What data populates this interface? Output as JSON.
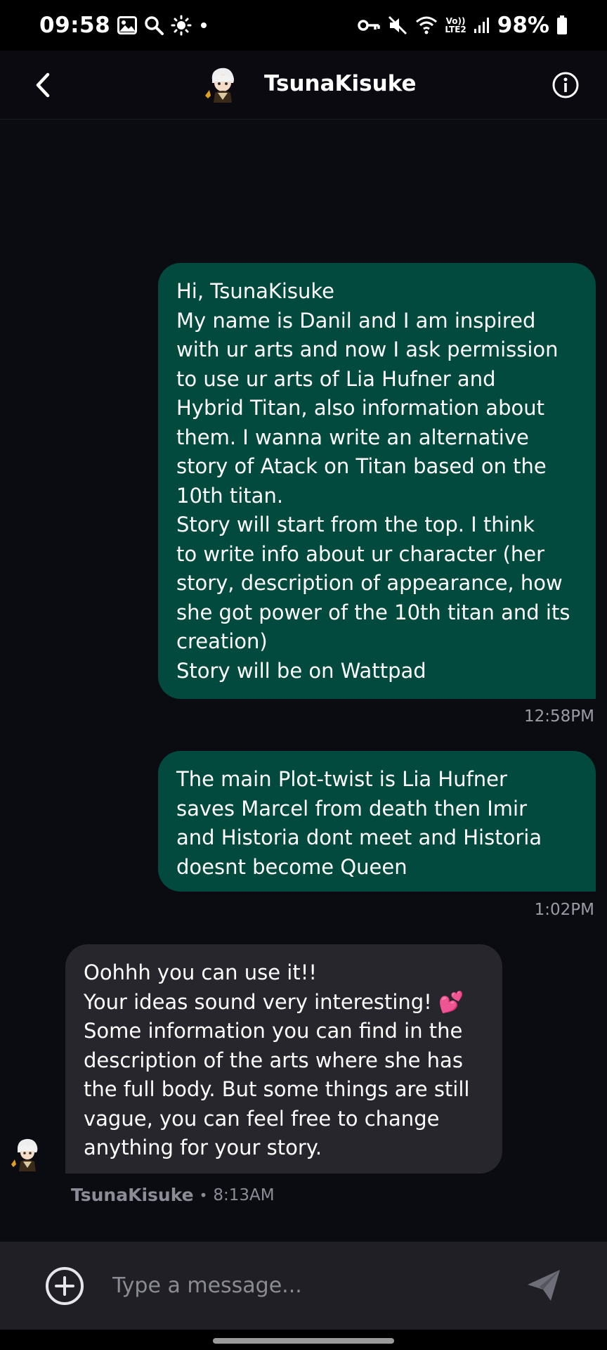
{
  "status_bar": {
    "time": "09:58",
    "battery": "98%",
    "volte": "Vo))",
    "lte": "LTE2",
    "icons_left": [
      "gallery-icon",
      "search-icon",
      "brightness-icon",
      "dot-icon"
    ],
    "icons_right": [
      "vpn-key-icon",
      "mute-icon",
      "wifi-icon",
      "signal-icon",
      "battery-icon"
    ]
  },
  "header": {
    "title": "TsunaKisuke",
    "back_icon": "chevron-left-icon",
    "info_icon": "info-icon"
  },
  "messages": [
    {
      "direction": "outgoing",
      "text": "Hi, TsunaKisuke\nMy name is Danil and I am inspired\nwith ur arts and now I ask permission\nto use ur arts of Lia Hufner and\nHybrid Titan, also information about\nthem. I wanna write an alternative\nstory of Atack on Titan based on the\n10th titan.\nStory will start from the top. I think\nto write info about ur character (her\nstory, description of appearance, how\nshe got power of the 10th titan and its\ncreation)\nStory will be on Wattpad",
      "time": "12:58PM"
    },
    {
      "direction": "outgoing",
      "text": "The main Plot-twist is Lia Hufner\nsaves Marcel from death then Imir\nand Historia dont meet and Historia\ndoesnt become Queen",
      "time": "1:02PM"
    },
    {
      "direction": "incoming",
      "text": "Oohhh you can use it!!\nYour ideas sound very interesting! 💕\nSome information you can find in the\ndescription of the arts where she has\nthe full body. But some things are still\nvague, you can feel free to change\nanything for your story.",
      "sender": "TsunaKisuke",
      "separator": "•",
      "time": "8:13AM"
    }
  ],
  "composer": {
    "placeholder": "Type a message...",
    "value": "",
    "add_icon": "plus-circle-icon",
    "send_icon": "send-icon"
  },
  "colors": {
    "background": "#0b0b12",
    "outgoing_bubble": "#014a3d",
    "incoming_bubble": "#26262c",
    "timestamp": "#9b9ba5"
  }
}
